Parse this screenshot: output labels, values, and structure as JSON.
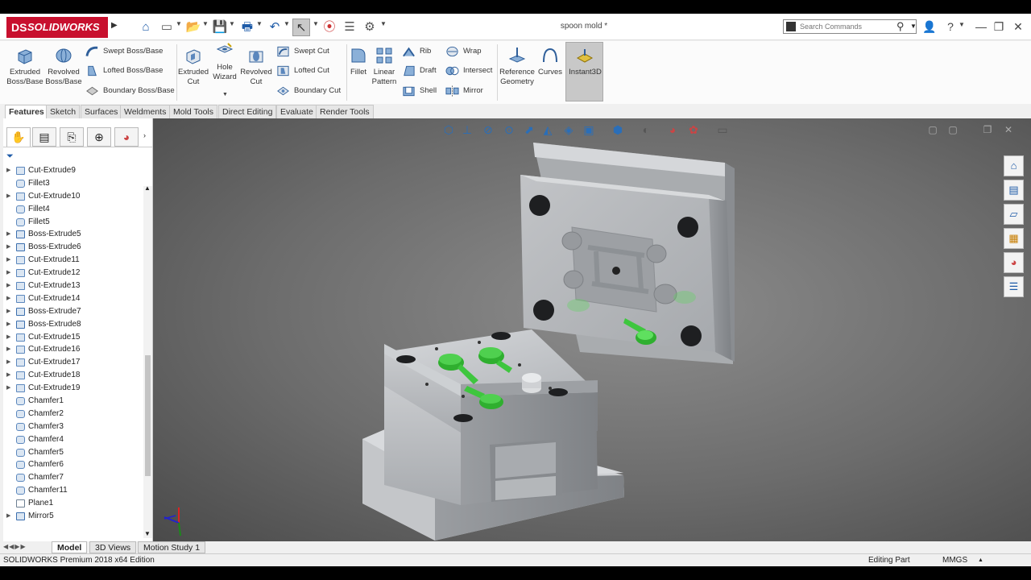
{
  "titlebar": {
    "app_name": "SOLIDWORKS",
    "ds_mark": "DS",
    "document_title": "spoon mold *",
    "search_placeholder": "Search Commands",
    "help_label": "?"
  },
  "ribbon": {
    "extruded_boss": "Extruded Boss/Base",
    "revolved_boss": "Revolved Boss/Base",
    "swept_boss": "Swept Boss/Base",
    "lofted_boss": "Lofted Boss/Base",
    "boundary_boss": "Boundary Boss/Base",
    "extruded_cut": "Extruded Cut",
    "hole_wizard": "Hole Wizard",
    "revolved_cut": "Revolved Cut",
    "swept_cut": "Swept Cut",
    "lofted_cut": "Lofted Cut",
    "boundary_cut": "Boundary Cut",
    "fillet": "Fillet",
    "linear_pattern": "Linear Pattern",
    "rib": "Rib",
    "draft": "Draft",
    "shell": "Shell",
    "wrap": "Wrap",
    "intersect": "Intersect",
    "mirror": "Mirror",
    "reference_geometry": "Reference Geometry",
    "curves": "Curves",
    "instant3d": "Instant3D"
  },
  "command_tabs": [
    "Features",
    "Sketch",
    "Surfaces",
    "Weldments",
    "Mold Tools",
    "Direct Editing",
    "Evaluate",
    "Render Tools"
  ],
  "tree_items": [
    {
      "label": "Cut-Extrude9",
      "expandable": true,
      "icon": "cut-extrude"
    },
    {
      "label": "Fillet3",
      "expandable": false,
      "icon": "fillet"
    },
    {
      "label": "Cut-Extrude10",
      "expandable": true,
      "icon": "cut-extrude"
    },
    {
      "label": "Fillet4",
      "expandable": false,
      "icon": "fillet"
    },
    {
      "label": "Fillet5",
      "expandable": false,
      "icon": "fillet"
    },
    {
      "label": "Boss-Extrude5",
      "expandable": true,
      "icon": "boss-extrude"
    },
    {
      "label": "Boss-Extrude6",
      "expandable": true,
      "icon": "boss-extrude"
    },
    {
      "label": "Cut-Extrude11",
      "expandable": true,
      "icon": "cut-extrude"
    },
    {
      "label": "Cut-Extrude12",
      "expandable": true,
      "icon": "cut-extrude"
    },
    {
      "label": "Cut-Extrude13",
      "expandable": true,
      "icon": "cut-extrude"
    },
    {
      "label": "Cut-Extrude14",
      "expandable": true,
      "icon": "cut-extrude"
    },
    {
      "label": "Boss-Extrude7",
      "expandable": true,
      "icon": "boss-extrude"
    },
    {
      "label": "Boss-Extrude8",
      "expandable": true,
      "icon": "boss-extrude"
    },
    {
      "label": "Cut-Extrude15",
      "expandable": true,
      "icon": "cut-extrude"
    },
    {
      "label": "Cut-Extrude16",
      "expandable": true,
      "icon": "cut-extrude"
    },
    {
      "label": "Cut-Extrude17",
      "expandable": true,
      "icon": "cut-extrude"
    },
    {
      "label": "Cut-Extrude18",
      "expandable": true,
      "icon": "cut-extrude"
    },
    {
      "label": "Cut-Extrude19",
      "expandable": true,
      "icon": "cut-extrude"
    },
    {
      "label": "Chamfer1",
      "expandable": false,
      "icon": "chamfer"
    },
    {
      "label": "Chamfer2",
      "expandable": false,
      "icon": "chamfer"
    },
    {
      "label": "Chamfer3",
      "expandable": false,
      "icon": "chamfer"
    },
    {
      "label": "Chamfer4",
      "expandable": false,
      "icon": "chamfer"
    },
    {
      "label": "Chamfer5",
      "expandable": false,
      "icon": "chamfer"
    },
    {
      "label": "Chamfer6",
      "expandable": false,
      "icon": "chamfer"
    },
    {
      "label": "Chamfer7",
      "expandable": false,
      "icon": "chamfer"
    },
    {
      "label": "Chamfer11",
      "expandable": false,
      "icon": "chamfer"
    },
    {
      "label": "Plane1",
      "expandable": false,
      "icon": "plane"
    },
    {
      "label": "Mirror5",
      "expandable": true,
      "icon": "mirror"
    }
  ],
  "bottom_tabs": [
    "Model",
    "3D Views",
    "Motion Study 1"
  ],
  "status": {
    "edition": "SOLIDWORKS Premium 2018 x64 Edition",
    "mode": "Editing Part",
    "units": "MMGS"
  },
  "colors": {
    "brand": "#c8102e",
    "accent": "#1e5ba8",
    "spoon_green": "#3ec63e",
    "mold_gray": "#c4c6c9"
  }
}
